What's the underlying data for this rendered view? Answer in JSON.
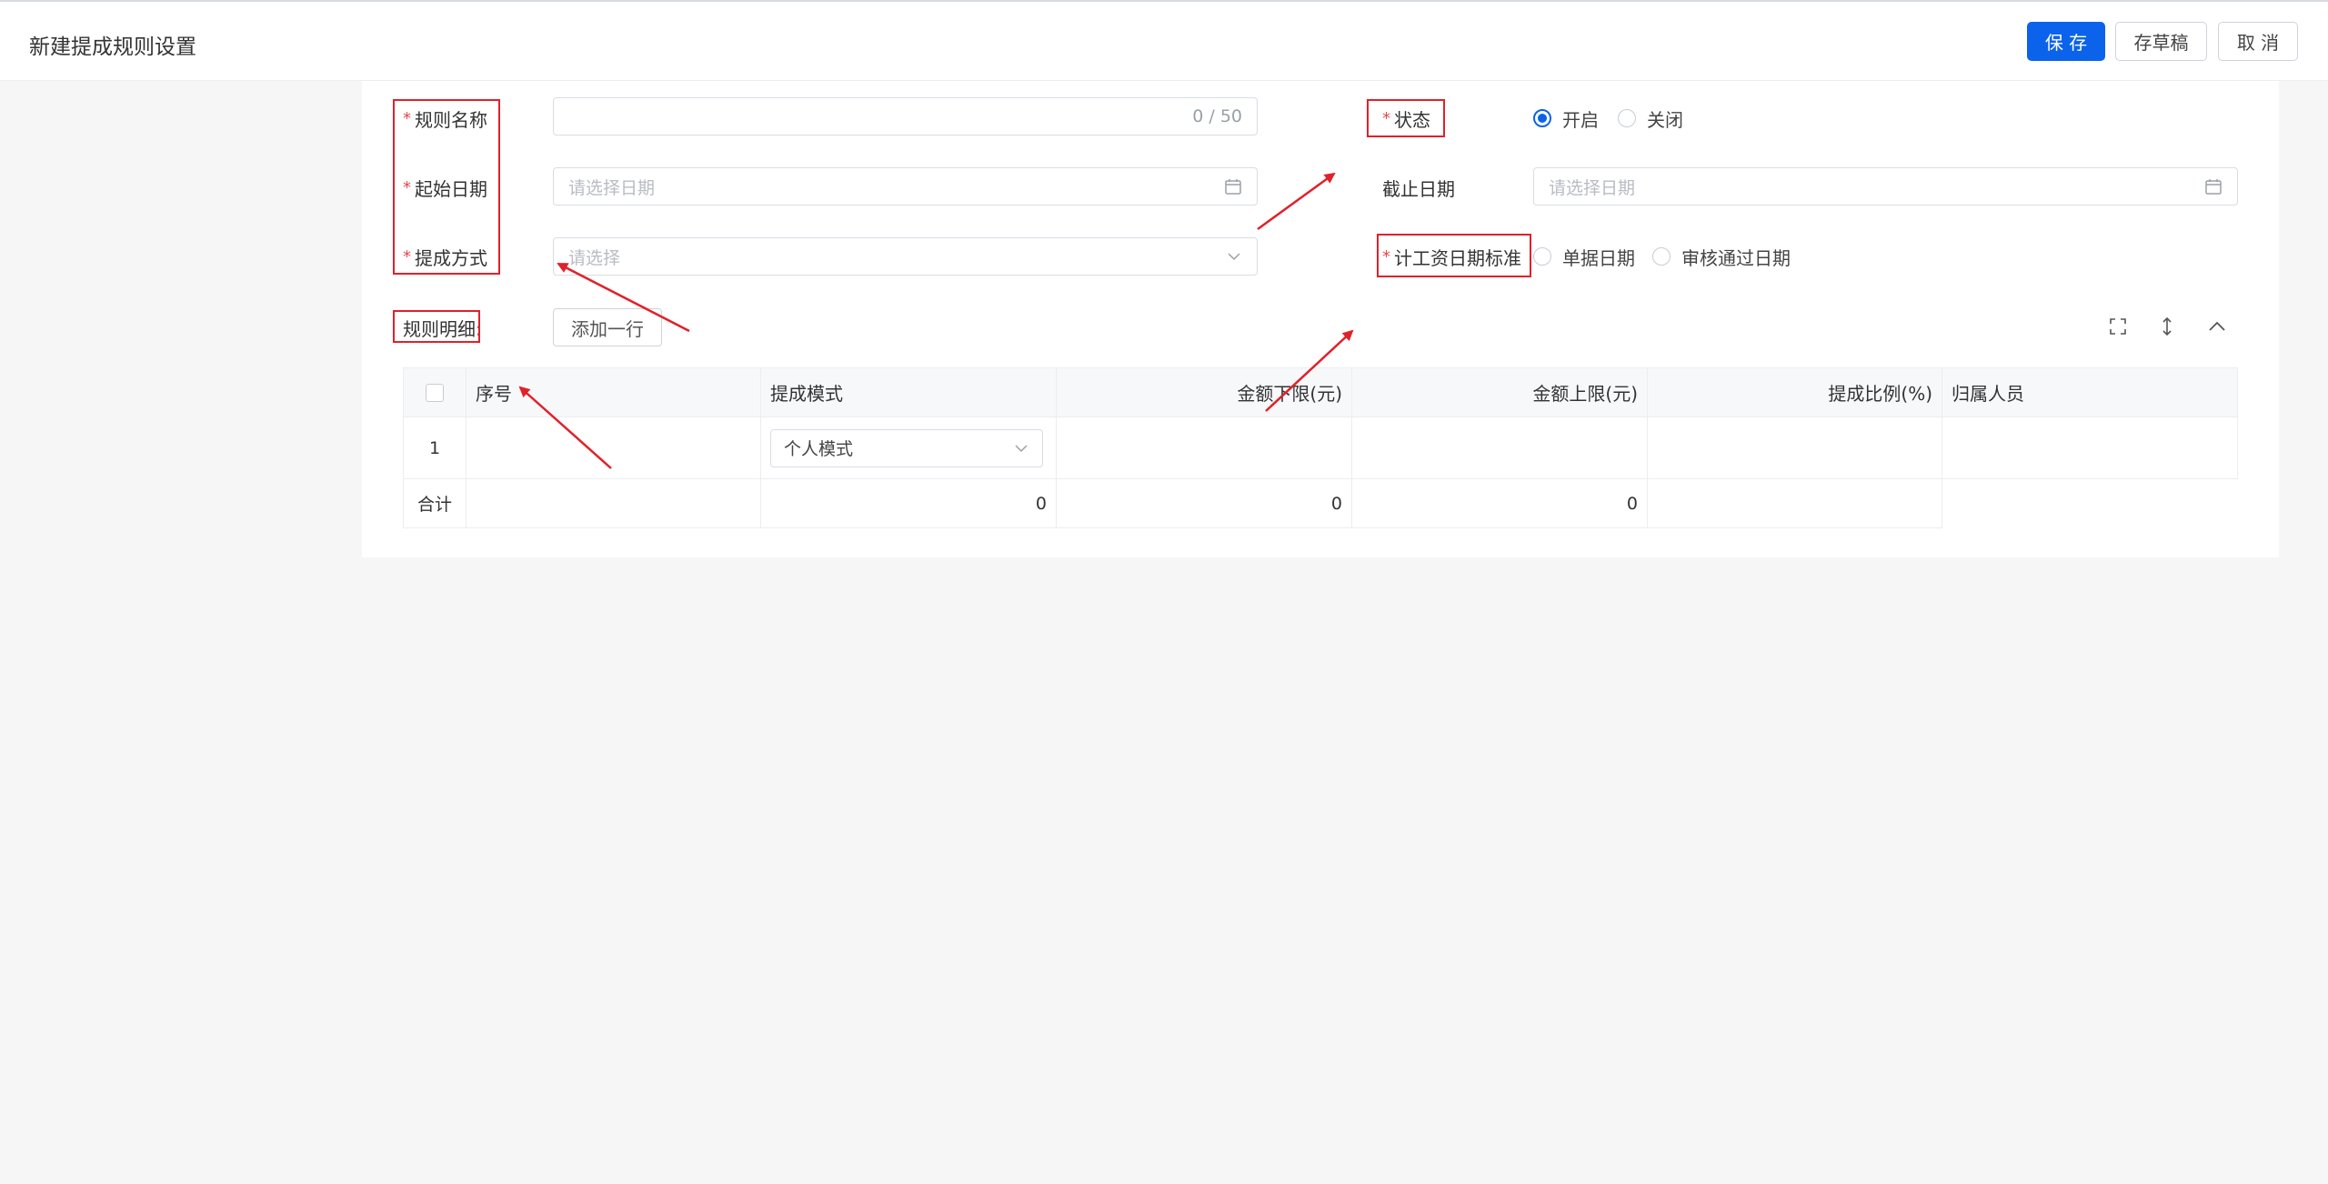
{
  "header": {
    "title": "新建提成规则设置",
    "save_label": "保 存",
    "draft_label": "存草稿",
    "cancel_label": "取 消"
  },
  "form": {
    "rule_name": {
      "label": "规则名称",
      "required": true,
      "value": "",
      "counter": "0 / 50"
    },
    "start_date": {
      "label": "起始日期",
      "required": true,
      "placeholder": "请选择日期"
    },
    "method": {
      "label": "提成方式",
      "required": true,
      "placeholder": "请选择"
    },
    "status": {
      "label": "状态",
      "required": true,
      "options": [
        "开启",
        "关闭"
      ],
      "selected": "开启"
    },
    "end_date": {
      "label": "截止日期",
      "required": false,
      "placeholder": "请选择日期"
    },
    "salary_date_standard": {
      "label": "计工资日期标准",
      "required": true,
      "options": [
        "单据日期",
        "审核通过日期"
      ],
      "selected": ""
    }
  },
  "details": {
    "label": "规则明细:",
    "add_row_label": "添加一行",
    "toolbar_icons": [
      "fullscreen-icon",
      "row-height-icon",
      "collapse-up-icon"
    ]
  },
  "table": {
    "columns": [
      "序号",
      "提成模式",
      "金额下限(元)",
      "金额上限(元)",
      "提成比例(%)",
      "归属人员"
    ],
    "rows": [
      {
        "index": "1",
        "mode": "个人模式",
        "lower": "",
        "upper": "",
        "ratio": "",
        "owner": ""
      }
    ],
    "summary": {
      "label": "合计",
      "c1": "0",
      "c2": "0",
      "c3": "0"
    }
  },
  "colors": {
    "primary": "#0a63ea",
    "required_mark": "#e5484d",
    "annotation_red": "#e0212a",
    "page_bg": "#f6f6f7"
  }
}
